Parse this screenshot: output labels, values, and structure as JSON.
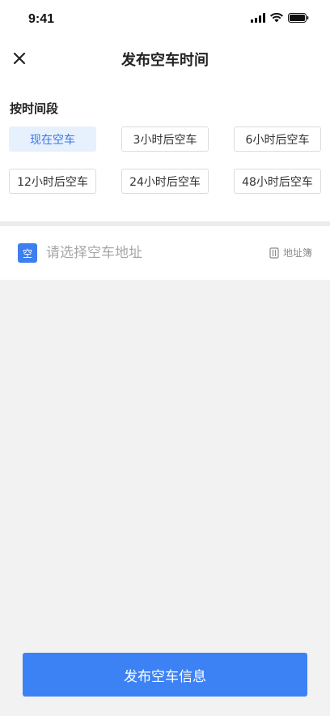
{
  "status_bar": {
    "time": "9:41"
  },
  "header": {
    "title": "发布空车时间"
  },
  "time_section": {
    "label": "按时间段",
    "options": [
      {
        "label": "现在空车",
        "selected": true
      },
      {
        "label": "3小时后空车",
        "selected": false
      },
      {
        "label": "6小时后空车",
        "selected": false
      },
      {
        "label": "12小时后空车",
        "selected": false
      },
      {
        "label": "24小时后空车",
        "selected": false
      },
      {
        "label": "48小时后空车",
        "selected": false
      }
    ]
  },
  "address": {
    "badge": "空",
    "placeholder": "请选择空车地址",
    "book_label": "地址簿"
  },
  "footer": {
    "publish_label": "发布空车信息"
  },
  "colors": {
    "accent": "#3d82f5",
    "selected_bg": "#e7f0fd",
    "selected_text": "#3a76e6"
  },
  "icons": {
    "close": "close-icon",
    "address_book": "address-book-icon"
  }
}
